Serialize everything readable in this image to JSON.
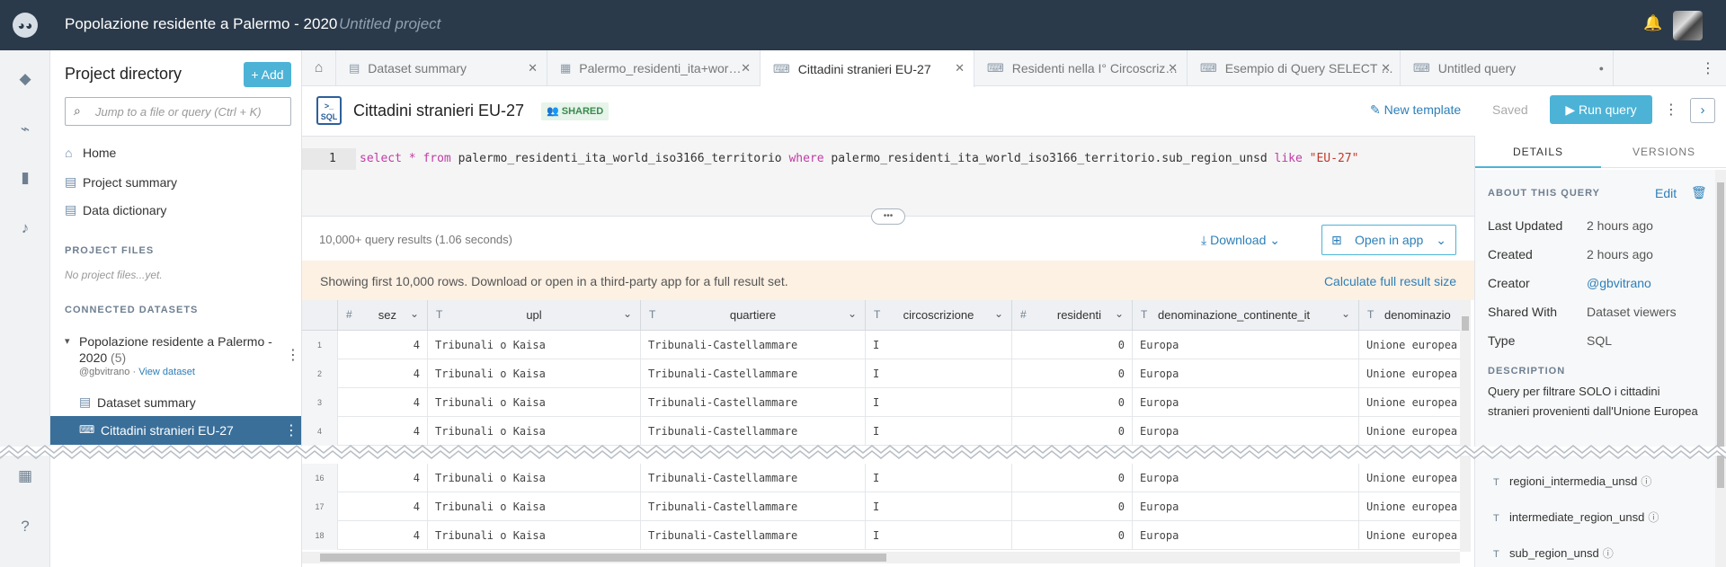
{
  "topbar": {
    "title": "Popolazione residente a Palermo - 2020",
    "subtitle": "Untitled project"
  },
  "sidebar": {
    "heading": "Project directory",
    "add_label": "+ Add",
    "search_placeholder": "Jump to a file or query (Ctrl + K)",
    "nav": [
      {
        "label": "Home",
        "icon": "home-icon"
      },
      {
        "label": "Project summary",
        "icon": "document-icon"
      },
      {
        "label": "Data dictionary",
        "icon": "document-icon"
      }
    ],
    "project_files_label": "PROJECT FILES",
    "project_files_empty": "No project files...yet.",
    "connected_datasets_label": "CONNECTED DATASETS",
    "dataset": {
      "title": "Popolazione residente a Palermo - 2020",
      "count": "(5)",
      "owner": "@gbvitrano ·",
      "view_link": "View dataset"
    },
    "dataset_items": [
      "Dataset summary",
      "Cittadini stranieri EU-27"
    ]
  },
  "tabs": [
    {
      "label": "Dataset summary",
      "icon": "document-icon",
      "closable": true,
      "active": false
    },
    {
      "label": "Palermo_residenti_ita+wor…",
      "icon": "table-icon",
      "closable": true,
      "active": false
    },
    {
      "label": "Cittadini stranieri EU-27",
      "icon": "sql-icon",
      "closable": true,
      "active": true
    },
    {
      "label": "Residenti nella I° Circoscriz…",
      "icon": "sql-icon",
      "closable": true,
      "active": false
    },
    {
      "label": "Esempio di Query SELECT …",
      "icon": "sql-icon",
      "closable": true,
      "active": false
    },
    {
      "label": "Untitled query",
      "icon": "sql-icon",
      "closable": false,
      "active": false
    }
  ],
  "query": {
    "icon_text": "SQL",
    "title": "Cittadini stranieri EU-27",
    "badge": "SHARED",
    "new_template": "New template",
    "saved": "Saved",
    "run": "Run query",
    "line_number": "1",
    "code": {
      "kw1": "select",
      "star": " * ",
      "kw2": "from",
      "table": " palermo_residenti_ita_world_iso3166_territorio ",
      "kw3": "where",
      "cond": " palermo_residenti_ita_world_iso3166_territorio.sub_region_unsd ",
      "kw4": "like",
      "value": " \"EU-27\""
    }
  },
  "results": {
    "info": "10,000+ query results (1.06 seconds)",
    "download": "Download",
    "open_in_app": "Open in app",
    "notice": "Showing first 10,000 rows. Download or open in a third-party app for a full result set.",
    "calculate": "Calculate full result size",
    "columns": [
      {
        "name": "sez",
        "type": "#"
      },
      {
        "name": "upl",
        "type": "T"
      },
      {
        "name": "quartiere",
        "type": "T"
      },
      {
        "name": "circoscrizione",
        "type": "T"
      },
      {
        "name": "residenti",
        "type": "#"
      },
      {
        "name": "denominazione_continente_it",
        "type": "T"
      },
      {
        "name": "denominazio",
        "type": "T"
      }
    ],
    "rows_top": [
      {
        "n": "1",
        "cells": [
          "4",
          "Tribunali o Kaisa",
          "Tribunali-Castellammare",
          "I",
          "0",
          "Europa",
          "Unione europea"
        ]
      },
      {
        "n": "2",
        "cells": [
          "4",
          "Tribunali o Kaisa",
          "Tribunali-Castellammare",
          "I",
          "0",
          "Europa",
          "Unione europea"
        ]
      },
      {
        "n": "3",
        "cells": [
          "4",
          "Tribunali o Kaisa",
          "Tribunali-Castellammare",
          "I",
          "0",
          "Europa",
          "Unione europea"
        ]
      },
      {
        "n": "4",
        "cells": [
          "4",
          "Tribunali o Kaisa",
          "Tribunali-Castellammare",
          "I",
          "0",
          "Europa",
          "Unione europea"
        ]
      }
    ],
    "rows_bottom": [
      {
        "n": "16",
        "cells": [
          "4",
          "Tribunali o Kaisa",
          "Tribunali-Castellammare",
          "I",
          "0",
          "Europa",
          "Unione europea"
        ]
      },
      {
        "n": "17",
        "cells": [
          "4",
          "Tribunali o Kaisa",
          "Tribunali-Castellammare",
          "I",
          "0",
          "Europa",
          "Unione europea"
        ]
      },
      {
        "n": "18",
        "cells": [
          "4",
          "Tribunali o Kaisa",
          "Tribunali-Castellammare",
          "I",
          "0",
          "Europa",
          "Unione europea"
        ]
      }
    ]
  },
  "details": {
    "tab_details": "DETAILS",
    "tab_versions": "VERSIONS",
    "about_label": "ABOUT THIS QUERY",
    "edit": "Edit",
    "fields": [
      {
        "k": "Last Updated",
        "v": "2 hours ago",
        "link": false
      },
      {
        "k": "Created",
        "v": "2 hours ago",
        "link": false
      },
      {
        "k": "Creator",
        "v": "@gbvitrano",
        "link": true
      },
      {
        "k": "Shared With",
        "v": "Dataset viewers",
        "link": false
      },
      {
        "k": "Type",
        "v": "SQL",
        "link": false
      }
    ],
    "description_label": "DESCRIPTION",
    "description": "Query per filtrare SOLO i cittadini stranieri provenienti dall'Unione Europea",
    "column_items": [
      "regioni_intermedia_unsd",
      "intermediate_region_unsd",
      "sub_region_unsd"
    ]
  }
}
